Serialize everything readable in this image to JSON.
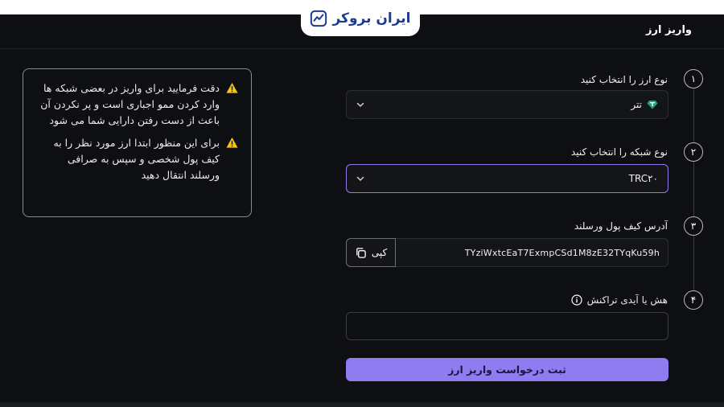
{
  "brand": {
    "name": "ایران بروکر",
    "color": "#1c3d8f"
  },
  "page": {
    "title": "واریز ارز"
  },
  "warnings": [
    {
      "icon": "warning-triangle-icon",
      "text": "دقت فرمایید برای واریز در بعضی شبکه ها وارد کردن ممو اجباری است و پر نکردن آن باعث از دست رفتن دارایی شما می شود"
    },
    {
      "icon": "warning-triangle-icon",
      "text": "برای این منظور ابتدا ارز مورد نظر را به کیف پول شخصی و سپس به صرافی ورسلند انتقال دهید"
    }
  ],
  "steps": [
    {
      "number": "۱",
      "label": "نوع ارز را انتخاب کنید",
      "value": "تتر",
      "icon": "tether-icon"
    },
    {
      "number": "۲",
      "label": "نوع شبکه را انتخاب کنید",
      "value": "TRC۲۰"
    },
    {
      "number": "۳",
      "label": "آدرس کیف پول ورسلند",
      "value": "TYziWxtcEaT7ExmpCSd1M8zE32TYqKu59h",
      "copy_label": "کپی"
    },
    {
      "number": "۴",
      "label": "هش یا آیدی تراکنش",
      "value": "",
      "placeholder": ""
    }
  ],
  "submit_label": "ثبت درخواست واریز ارز",
  "colors": {
    "accent": "#8f7cf0",
    "warning": "#f5c518",
    "tether": "#26a17b"
  }
}
